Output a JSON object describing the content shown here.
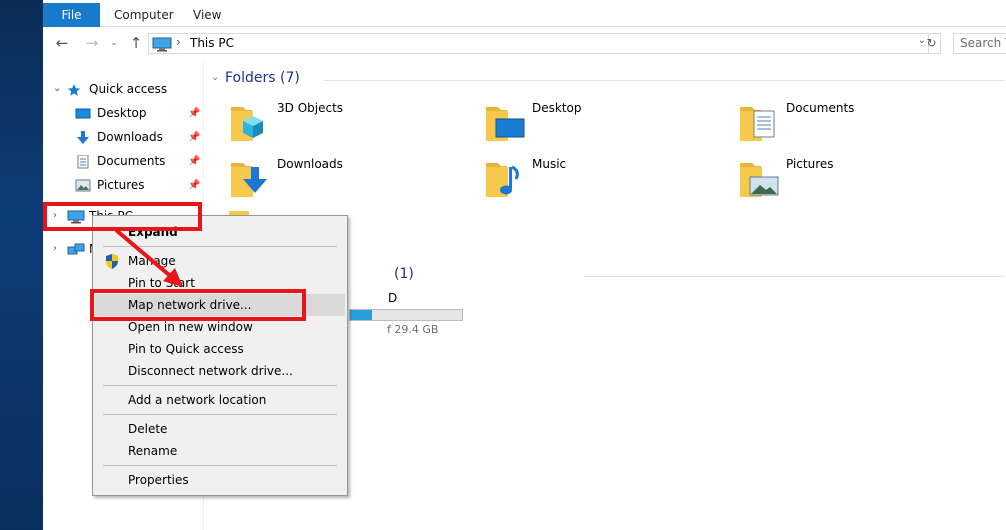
{
  "ribbon": {
    "tabs": [
      {
        "label": "File"
      },
      {
        "label": "Computer"
      },
      {
        "label": "View"
      }
    ]
  },
  "address": {
    "crumb": "This PC",
    "search_placeholder": "Search T"
  },
  "nav_pane": {
    "quick_access": "Quick access",
    "items": [
      {
        "label": "Desktop",
        "icon": "desktop-icon"
      },
      {
        "label": "Downloads",
        "icon": "downloads-icon"
      },
      {
        "label": "Documents",
        "icon": "documents-icon"
      },
      {
        "label": "Pictures",
        "icon": "pictures-icon"
      }
    ],
    "this_pc": "This PC",
    "network": "N"
  },
  "content": {
    "folders_header": "Folders (7)",
    "folders": [
      {
        "label": "3D Objects",
        "icon": "3d-objects-folder-icon"
      },
      {
        "label": "Desktop",
        "icon": "desktop-folder-icon"
      },
      {
        "label": "Documents",
        "icon": "documents-folder-icon"
      },
      {
        "label": "Downloads",
        "icon": "downloads-folder-icon"
      },
      {
        "label": "Music",
        "icon": "music-folder-icon"
      },
      {
        "label": "Pictures",
        "icon": "pictures-folder-icon"
      }
    ],
    "devices_header": "(1)",
    "drive_label": "D",
    "drive_free": "f 29.4 GB",
    "drive_used_fraction": 0.2
  },
  "context_menu": {
    "items": [
      {
        "label": "Expand"
      },
      {
        "label": "Manage"
      },
      {
        "label": "Pin to Start"
      },
      {
        "label": "Map network drive..."
      },
      {
        "label": "Open in new window"
      },
      {
        "label": "Pin to Quick access"
      },
      {
        "label": "Disconnect network drive..."
      },
      {
        "label": "Add a network location"
      },
      {
        "label": "Delete"
      },
      {
        "label": "Rename"
      },
      {
        "label": "Properties"
      }
    ]
  },
  "colors": {
    "accent": "#1979ca",
    "highlight_red": "#e8151b",
    "group_header": "#1e3287",
    "folder_yellow": "#f6c94c"
  }
}
